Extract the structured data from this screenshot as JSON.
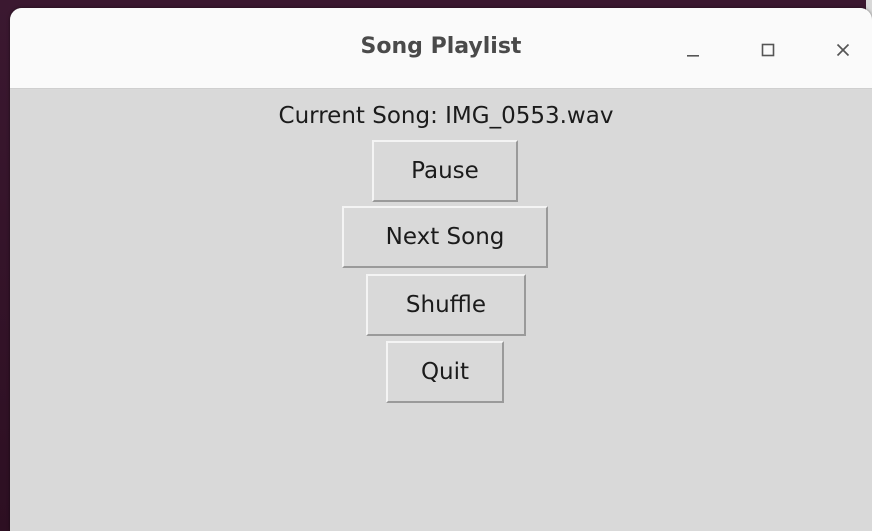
{
  "window": {
    "title": "Song Playlist",
    "controls": {
      "minimize": "minimize-icon",
      "maximize": "maximize-icon",
      "close": "close-icon"
    }
  },
  "player": {
    "current_song_label": "Current Song: IMG_0553.wav"
  },
  "buttons": {
    "pause": "Pause",
    "next_song": "Next Song",
    "shuffle": "Shuffle",
    "quit": "Quit"
  },
  "colors": {
    "window_bg": "#d9d9d9",
    "titlebar_bg": "#fafafa",
    "desktop_bg": "#3a1a2c"
  }
}
